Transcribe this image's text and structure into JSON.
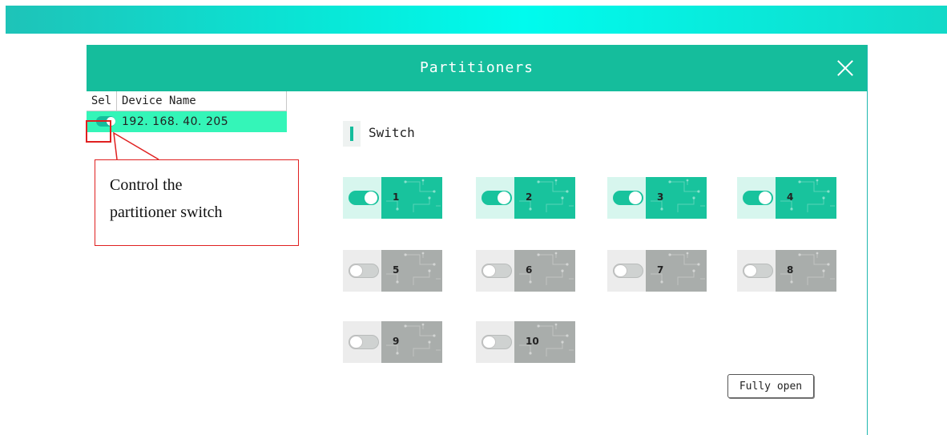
{
  "window": {
    "title": "Partitioners"
  },
  "device_table": {
    "headers": {
      "sel": "Sel",
      "device_name": "Device Name"
    },
    "rows": [
      {
        "ip": "192. 168. 40. 205",
        "selected": true
      }
    ]
  },
  "annotation": {
    "line1": "Control the",
    "line2": "partitioner switch"
  },
  "section": {
    "title": "Switch"
  },
  "zones": [
    {
      "label": "1",
      "on": true
    },
    {
      "label": "2",
      "on": true
    },
    {
      "label": "3",
      "on": true
    },
    {
      "label": "4",
      "on": true
    },
    {
      "label": "5",
      "on": false
    },
    {
      "label": "6",
      "on": false
    },
    {
      "label": "7",
      "on": false
    },
    {
      "label": "8",
      "on": false
    },
    {
      "label": "9",
      "on": false
    },
    {
      "label": "10",
      "on": false
    }
  ],
  "buttons": {
    "fully_open": "Fully open"
  },
  "colors": {
    "accent": "#15bd9c",
    "highlight_row": "#34f5b8",
    "off_face": "#a9adab",
    "annotation": "#e02020"
  }
}
